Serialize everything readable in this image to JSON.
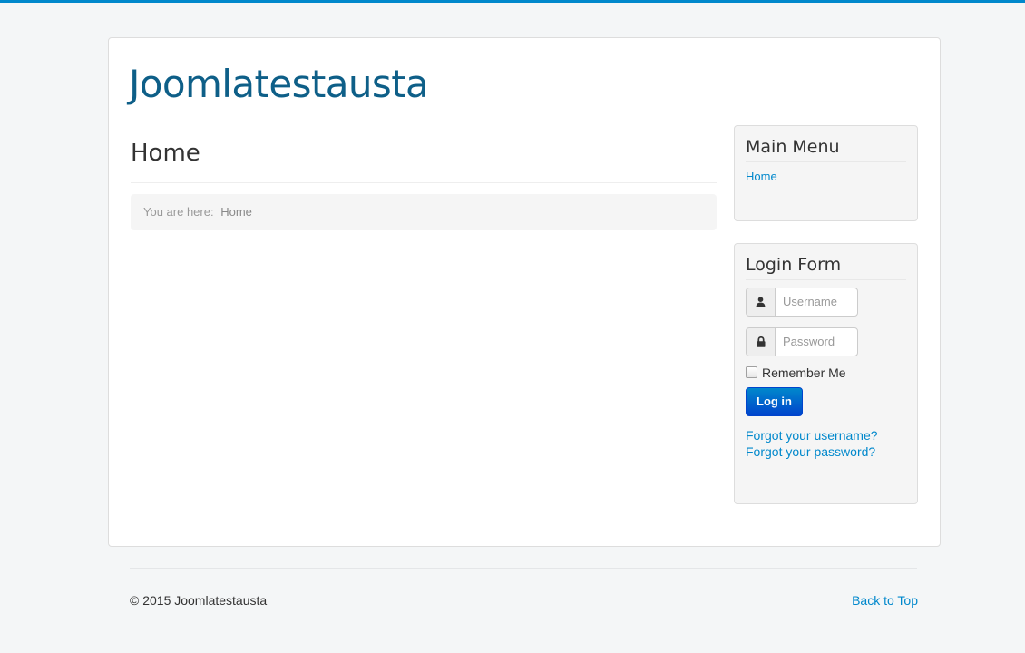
{
  "site": {
    "title": "Joomlatestausta"
  },
  "main": {
    "page_title": "Home",
    "breadcrumb": {
      "prefix": "You are here:",
      "current": "Home"
    }
  },
  "sidebar": {
    "main_menu": {
      "title": "Main Menu",
      "items": [
        {
          "label": "Home"
        }
      ]
    },
    "login_form": {
      "title": "Login Form",
      "username_placeholder": "Username",
      "password_placeholder": "Password",
      "remember_label": "Remember Me",
      "remember_checked": false,
      "login_button": "Log in",
      "forgot_username": "Forgot your username?",
      "forgot_password": "Forgot your password?",
      "icons": {
        "username": "user-icon",
        "password": "lock-icon"
      }
    }
  },
  "footer": {
    "copyright": "© 2015 Joomlatestausta",
    "back_to_top": "Back to Top"
  },
  "colors": {
    "top_bar": "#0088cc",
    "site_title": "#0e5f88",
    "link": "#0088cc",
    "primary_button": "#0044cc",
    "background": "#f4f6f7"
  }
}
